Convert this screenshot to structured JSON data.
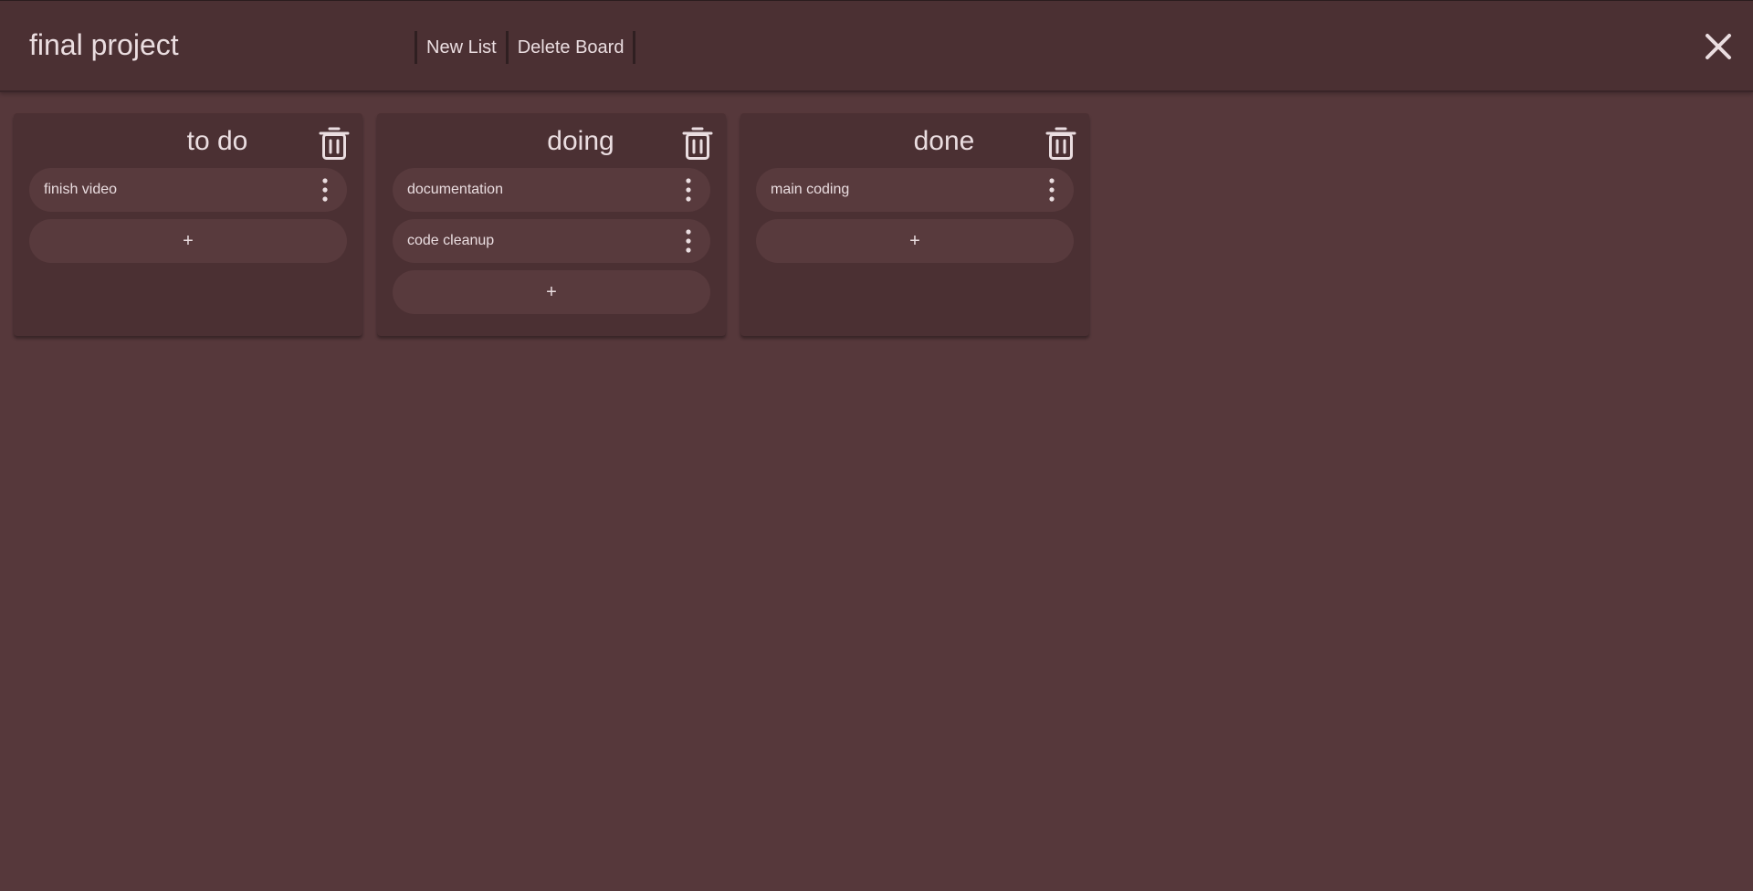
{
  "board": {
    "title": "final project"
  },
  "toolbar": {
    "new_list_label": "New List",
    "delete_board_label": "Delete Board"
  },
  "icons": {
    "close": "close-icon",
    "trash": "trash-icon",
    "menu": "vertical-dots-icon"
  },
  "colors": {
    "background": "#56383b",
    "topbar": "#4b3033",
    "list": "#4b3033",
    "card": "#583a3d",
    "text": "#eadde0"
  },
  "lists": [
    {
      "title": "to do",
      "cards": [
        "finish video"
      ],
      "add_label": "+"
    },
    {
      "title": "doing",
      "cards": [
        "documentation",
        "code cleanup"
      ],
      "add_label": "+"
    },
    {
      "title": "done",
      "cards": [
        "main coding"
      ],
      "add_label": "+"
    }
  ]
}
